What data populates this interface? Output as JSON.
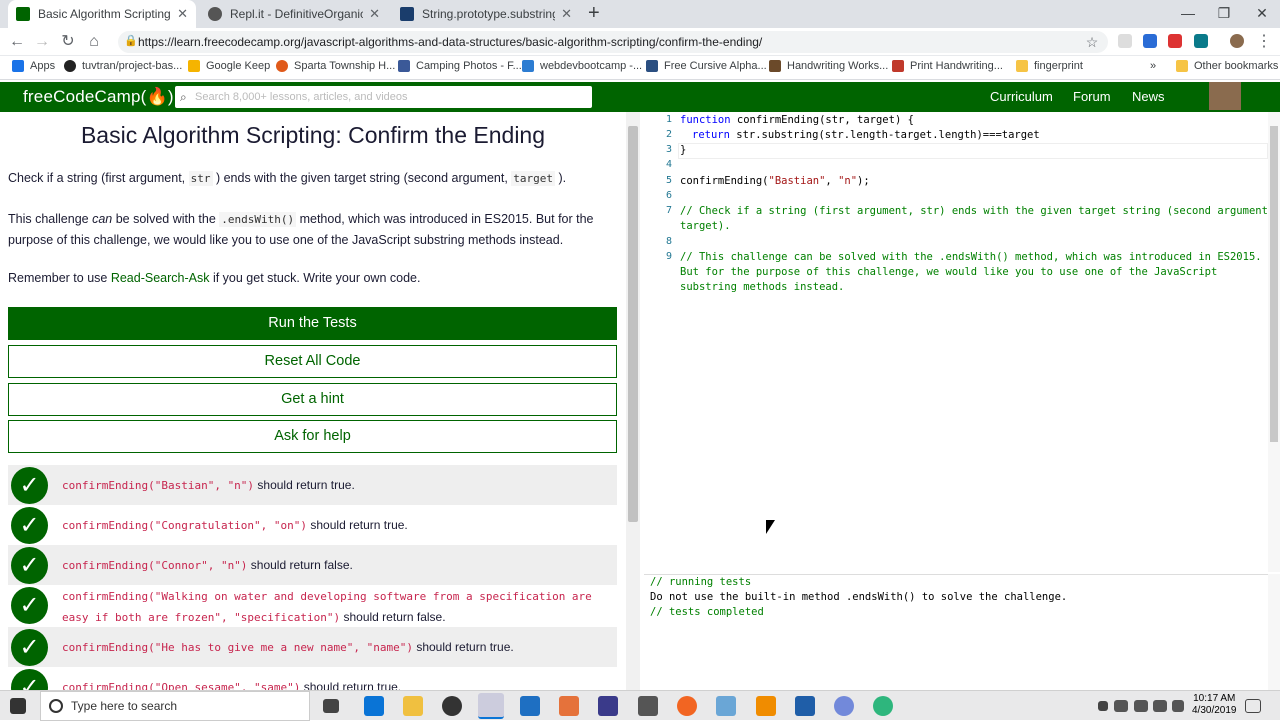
{
  "browser": {
    "tabs": [
      {
        "title": "Basic Algorithm Scripting: Confir",
        "active": true
      },
      {
        "title": "Repl.it - DefinitiveOrganicDiction",
        "active": false
      },
      {
        "title": "String.prototype.substring() - Jav",
        "active": false
      }
    ],
    "url": "https://learn.freecodecamp.org/javascript-algorithms-and-data-structures/basic-algorithm-scripting/confirm-the-ending/",
    "bookmarks": [
      "Apps",
      "tuvtran/project-bas...",
      "Google Keep",
      "Sparta Township H...",
      "Camping Photos - F...",
      "webdevbootcamp -...",
      "Free Cursive Alpha...",
      "Handwriting Works...",
      "Print Handwriting...",
      "fingerprint",
      "Other bookmarks"
    ]
  },
  "fcc": {
    "logo": "freeCodeCamp(🔥)",
    "search_placeholder": "Search 8,000+ lessons, articles, and videos",
    "nav": [
      "Curriculum",
      "Forum",
      "News"
    ]
  },
  "challenge": {
    "title": "Basic Algorithm Scripting: Confirm the Ending",
    "p1_a": "Check if a string (first argument, ",
    "p1_code1": "str",
    "p1_b": " ) ends with the given target string (second argument, ",
    "p1_code2": "target",
    "p1_c": " ).",
    "p2_a": "This challenge ",
    "p2_em": "can",
    "p2_b": " be solved with the ",
    "p2_code": ".endsWith()",
    "p2_c": " method, which was introduced in ES2015. But for the purpose of this challenge, we would like you to use one of the JavaScript substring methods instead.",
    "p3_a": "Remember to use ",
    "p3_link": "Read-Search-Ask",
    "p3_b": " if you get stuck. Write your own code.",
    "buttons": {
      "run": "Run the Tests",
      "reset": "Reset All Code",
      "hint": "Get a hint",
      "help": "Ask for help"
    },
    "tests": [
      {
        "code": "confirmEnding(\"Bastian\", \"n\")",
        "text": " should return true."
      },
      {
        "code": "confirmEnding(\"Congratulation\", \"on\")",
        "text": " should return true."
      },
      {
        "code": "confirmEnding(\"Connor\", \"n\")",
        "text": " should return false."
      },
      {
        "code": "confirmEnding(\"Walking on water and developing software from a specification are easy if both are frozen\", \"specification\")",
        "text": " should return false."
      },
      {
        "code": "confirmEnding(\"He has to give me a new name\", \"name\")",
        "text": " should return true."
      },
      {
        "code": "confirmEnding(\"Open sesame\", \"same\")",
        "text": " should return true."
      }
    ]
  },
  "editor": {
    "line_numbers": [
      "1",
      "2",
      "3",
      "4",
      "5",
      "6",
      "7",
      "8",
      "9"
    ],
    "l1_kw": "function",
    "l1_rest": " confirmEnding(str, target) {",
    "l2_kw": "return",
    "l2_rest": " str.substring(str.length-target.length)===target",
    "l3": "}",
    "l5_a": "confirmEnding(",
    "l5_s1": "\"Bastian\"",
    "l5_b": ", ",
    "l5_s2": "\"n\"",
    "l5_c": ");",
    "l7a": "// Check if a string (first argument, str) ends with the given target string (second argument,",
    "l7b": "target).",
    "l9a": "// This challenge can be solved with the .endsWith() method, which was introduced in ES2015.",
    "l9b": "But for the purpose of this challenge, we would like you to use one of the JavaScript",
    "l9c": "substring methods instead."
  },
  "console": {
    "line1": "// running tests",
    "line2": "Do not use the built-in method .endsWith() to solve the challenge.",
    "line3": "// tests completed"
  },
  "taskbar": {
    "search_placeholder": "Type here to search",
    "time": "10:17 AM",
    "date": "4/30/2019"
  }
}
